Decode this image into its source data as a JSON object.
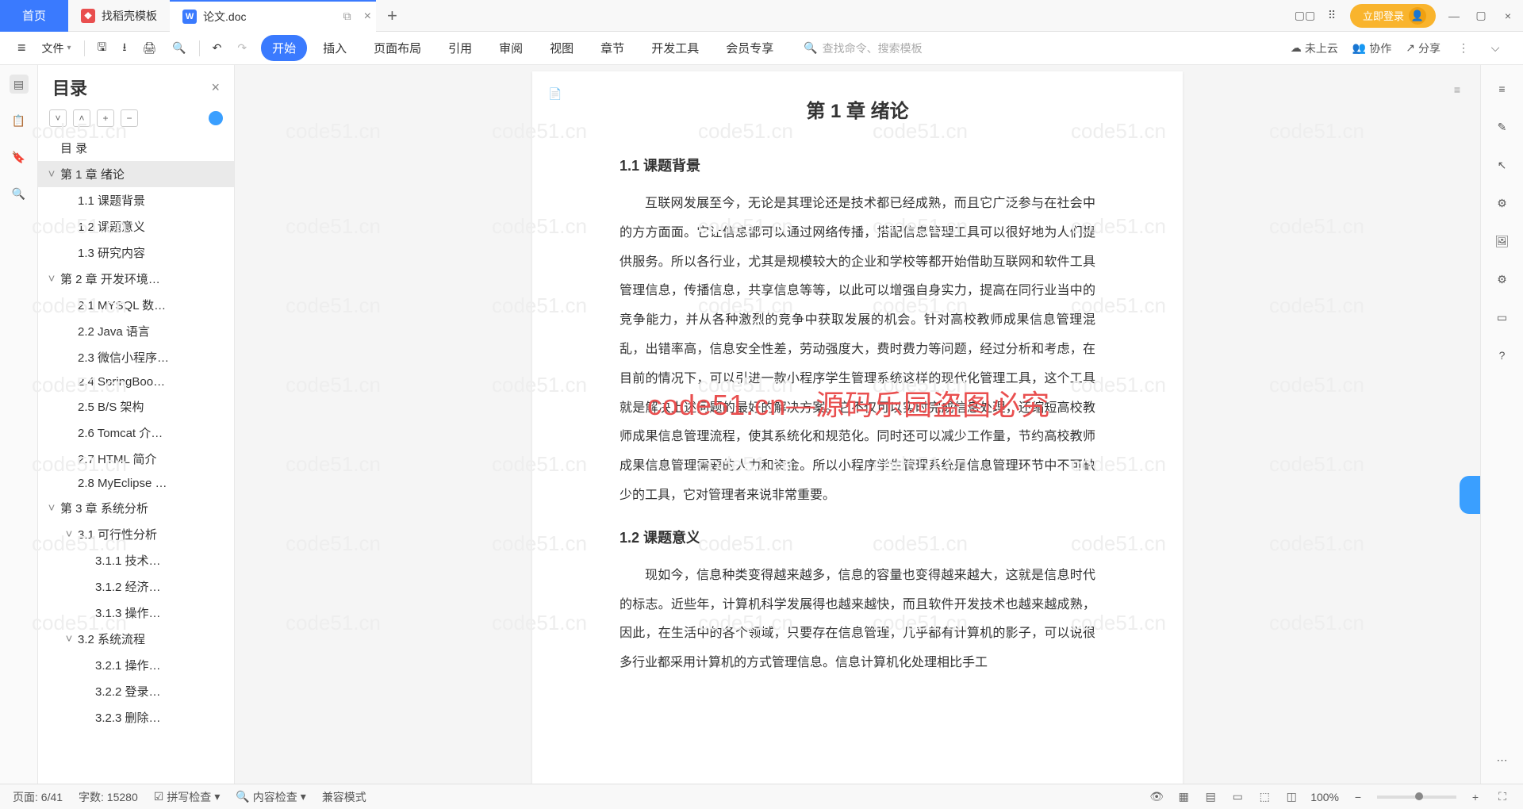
{
  "tabs": {
    "home": "首页",
    "t1": "找稻壳模板",
    "t2": "论文.doc"
  },
  "toolbar": {
    "file": "文件"
  },
  "ribbon": [
    "开始",
    "插入",
    "页面布局",
    "引用",
    "审阅",
    "视图",
    "章节",
    "开发工具",
    "会员专享"
  ],
  "search_placeholder": "查找命令、搜索模板",
  "cloud": "未上云",
  "coop": "协作",
  "share": "分享",
  "login": "立即登录",
  "outline": {
    "title": "目录",
    "items": [
      {
        "lvl": 1,
        "exp": "",
        "txt": "目  录"
      },
      {
        "lvl": 1,
        "exp": "˅",
        "txt": "第 1 章  绪论",
        "sel": true
      },
      {
        "lvl": 2,
        "exp": "",
        "txt": "1.1  课题背景"
      },
      {
        "lvl": 2,
        "exp": "",
        "txt": "1.2  课题意义"
      },
      {
        "lvl": 2,
        "exp": "",
        "txt": "1.3  研究内容"
      },
      {
        "lvl": 1,
        "exp": "˅",
        "txt": "第 2 章  开发环境…"
      },
      {
        "lvl": 2,
        "exp": "",
        "txt": "2.1 MYSQL 数…"
      },
      {
        "lvl": 2,
        "exp": "",
        "txt": "2.2 Java 语言"
      },
      {
        "lvl": 2,
        "exp": "",
        "txt": "2.3  微信小程序…"
      },
      {
        "lvl": 2,
        "exp": "",
        "txt": "2.4 SpringBoo…"
      },
      {
        "lvl": 2,
        "exp": "",
        "txt": "2.5 B/S 架构"
      },
      {
        "lvl": 2,
        "exp": "",
        "txt": "2.6 Tomcat   介…"
      },
      {
        "lvl": 2,
        "exp": "",
        "txt": "2.7 HTML 简介"
      },
      {
        "lvl": 2,
        "exp": "",
        "txt": "2.8 MyEclipse …"
      },
      {
        "lvl": 1,
        "exp": "˅",
        "txt": "第 3 章  系统分析"
      },
      {
        "lvl": 2,
        "exp": "˅",
        "txt": "3.1  可行性分析"
      },
      {
        "lvl": 3,
        "exp": "",
        "txt": "3.1.1  技术…"
      },
      {
        "lvl": 3,
        "exp": "",
        "txt": "3.1.2  经济…"
      },
      {
        "lvl": 3,
        "exp": "",
        "txt": "3.1.3  操作…"
      },
      {
        "lvl": 2,
        "exp": "˅",
        "txt": "3.2  系统流程"
      },
      {
        "lvl": 3,
        "exp": "",
        "txt": "3.2.1  操作…"
      },
      {
        "lvl": 3,
        "exp": "",
        "txt": "3.2.2  登录…"
      },
      {
        "lvl": 3,
        "exp": "",
        "txt": "3.2.3  删除…"
      }
    ]
  },
  "doc": {
    "chapter": "第 1 章  绪论",
    "s11": "1.1  课题背景",
    "p1": "互联网发展至今，无论是其理论还是技术都已经成熟，而且它广泛参与在社会中的方方面面。它让信息都可以通过网络传播，搭配信息管理工具可以很好地为人们提供服务。所以各行业，尤其是规模较大的企业和学校等都开始借助互联网和软件工具管理信息，传播信息，共享信息等等，以此可以增强自身实力，提高在同行业当中的竞争能力，并从各种激烈的竞争中获取发展的机会。针对高校教师成果信息管理混乱，出错率高，信息安全性差，劳动强度大，费时费力等问题，经过分析和考虑，在目前的情况下，可以引进一款小程序学生管理系统这样的现代化管理工具，这个工具就是解决上述问题的最好的解决方案。它不仅可以实时完成信息处理，还缩短高校教师成果信息管理流程，使其系统化和规范化。同时还可以减少工作量，节约高校教师成果信息管理需要的人力和资金。所以小程序学生管理系统是信息管理环节中不可缺少的工具，它对管理者来说非常重要。",
    "s12": "1.2  课题意义",
    "p2": "现如今，信息种类变得越来越多，信息的容量也变得越来越大，这就是信息时代的标志。近些年，计算机科学发展得也越来越快，而且软件开发技术也越来越成熟，因此，在生活中的各个领域，只要存在信息管理，几乎都有计算机的影子，可以说很多行业都采用计算机的方式管理信息。信息计算机化处理相比手工"
  },
  "watermark": "code51.cn—源码乐园盗图必究",
  "wm_bg": "code51.cn",
  "status": {
    "page": "页面: 6/41",
    "words": "字数: 15280",
    "spell": "拼写检查",
    "content": "内容检查",
    "compat": "兼容模式",
    "zoom": "100%"
  }
}
